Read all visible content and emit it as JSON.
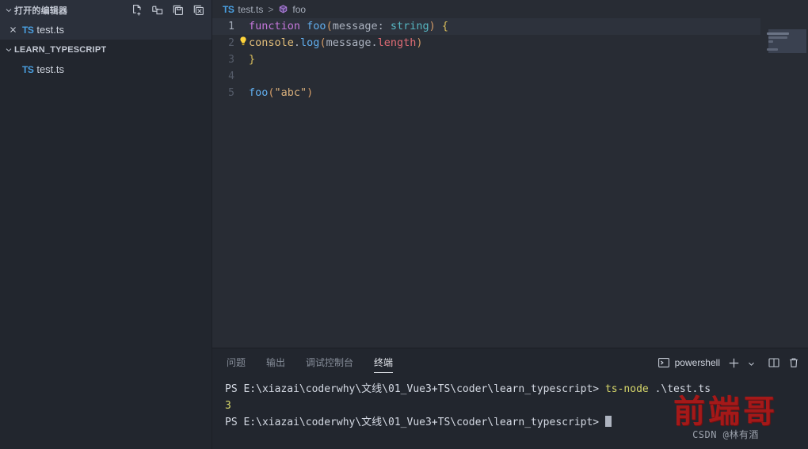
{
  "sidebar": {
    "open_editors": {
      "title": "打开的编辑器",
      "chevron": "chevron-down-icon",
      "actions": [
        {
          "name": "new-file-icon",
          "title": "新建文件"
        },
        {
          "name": "new-folder-icon",
          "title": "新建文件夹"
        },
        {
          "name": "save-all-icon",
          "title": "全部保存"
        },
        {
          "name": "close-all-icon",
          "title": "全部关闭"
        }
      ],
      "items": [
        {
          "close": "×",
          "badge": "TS",
          "label": "test.ts"
        }
      ]
    },
    "explorer": {
      "title": "LEARN_TYPESCRIPT",
      "chevron": "chevron-down-icon",
      "items": [
        {
          "badge": "TS",
          "label": "test.ts"
        }
      ]
    }
  },
  "breadcrumb": {
    "badge": "TS",
    "file": "test.ts",
    "separator": ">",
    "symbol_icon": "symbol-method-icon",
    "symbol": "foo"
  },
  "editor": {
    "lines": [
      {
        "num": "1",
        "active": true,
        "bulb": false
      },
      {
        "num": "2",
        "active": false,
        "bulb": true
      },
      {
        "num": "3",
        "active": false,
        "bulb": false
      },
      {
        "num": "4",
        "active": false,
        "bulb": false
      },
      {
        "num": "5",
        "active": false,
        "bulb": false
      }
    ],
    "code": {
      "l1_kw": "function",
      "l1_space1": " ",
      "l1_fn": "foo",
      "l1_paren_open": "(",
      "l1_param": "message",
      "l1_colon": ": ",
      "l1_type": "string",
      "l1_paren_close": ")",
      "l1_brace": " {",
      "l2_obj": "console",
      "l2_dot1": ".",
      "l2_prop": "log",
      "l2_paren_open": "(",
      "l2_param": "message",
      "l2_dot2": ".",
      "l2_length": "length",
      "l2_paren_close": ")",
      "l3_brace": "}",
      "l4_blank": "",
      "l5_fn": "foo",
      "l5_paren_open": "(",
      "l5_str": "\"abc\"",
      "l5_paren_close": ")"
    }
  },
  "panel": {
    "tabs": [
      {
        "label": "问题",
        "active": false
      },
      {
        "label": "输出",
        "active": false
      },
      {
        "label": "调试控制台",
        "active": false
      },
      {
        "label": "终端",
        "active": true
      }
    ],
    "terminal_chip": {
      "icon": "terminal-icon",
      "label": "powershell"
    },
    "actions": [
      {
        "name": "add-terminal-icon",
        "glyph": "+"
      },
      {
        "name": "chevron-down-icon",
        "glyph": "⌄"
      },
      {
        "name": "split-terminal-icon",
        "glyph": "▥"
      },
      {
        "name": "kill-terminal-icon",
        "glyph": "🗑"
      }
    ]
  },
  "terminal": {
    "prompt": "PS E:\\xiazai\\coderwhy\\文线\\01_Vue3+TS\\coder\\learn_typescript> ",
    "command_name": "ts-node",
    "command_arg": " .\\test.ts",
    "output": "3",
    "prompt2": "PS E:\\xiazai\\coderwhy\\文线\\01_Vue3+TS\\coder\\learn_typescript> "
  },
  "watermark": {
    "main": "前端哥",
    "sub": "CSDN @林有酒"
  },
  "colors": {
    "sidebar_bg": "#22262e",
    "editor_bg": "#282c34",
    "accent_blue": "#61afef",
    "ts_blue": "#4a9fe0",
    "keyword_purple": "#c678dd",
    "string_green": "#98c379",
    "terminal_yellow": "#d7d76a",
    "watermark_red": "#b01818"
  }
}
